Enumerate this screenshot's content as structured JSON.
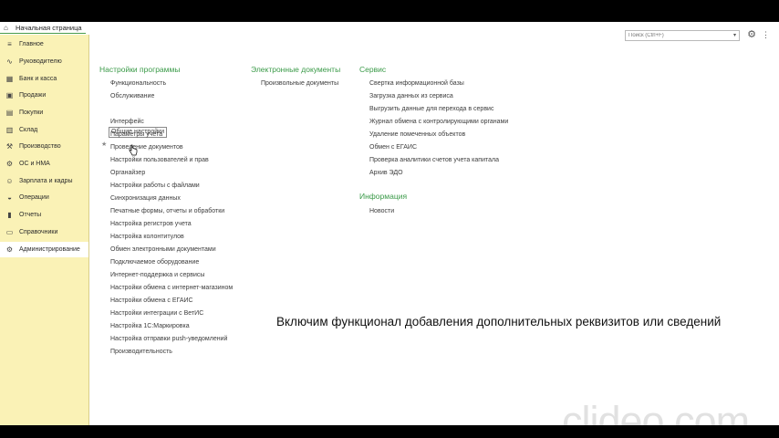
{
  "tab": {
    "home_label": "Начальная страница"
  },
  "sidebar": {
    "items": [
      {
        "label": "Главное",
        "icon": "menu-icon"
      },
      {
        "label": "Руководителю",
        "icon": "chart-icon"
      },
      {
        "label": "Банк и касса",
        "icon": "bank-icon"
      },
      {
        "label": "Продажи",
        "icon": "sales-icon"
      },
      {
        "label": "Покупки",
        "icon": "cart-icon"
      },
      {
        "label": "Склад",
        "icon": "warehouse-icon"
      },
      {
        "label": "Производство",
        "icon": "production-icon"
      },
      {
        "label": "ОС и НМА",
        "icon": "assets-icon"
      },
      {
        "label": "Зарплата и кадры",
        "icon": "people-icon"
      },
      {
        "label": "Операции",
        "icon": "operations-icon"
      },
      {
        "label": "Отчеты",
        "icon": "reports-icon"
      },
      {
        "label": "Справочники",
        "icon": "book-icon"
      },
      {
        "label": "Администрирование",
        "icon": "gear-icon"
      }
    ],
    "active_index": 12
  },
  "search": {
    "placeholder": "Поиск (Ctrl+F)"
  },
  "sections": {
    "settings": {
      "title": "Настройки программы",
      "links": [
        "Функциональность",
        "Обслуживание",
        "Общие настройки",
        "Интерфейс",
        "Параметры учета",
        "Проведение документов",
        "Настройки пользователей и прав",
        "Органайзер",
        "Настройки работы с файлами",
        "Синхронизация данных",
        "Печатные формы, отчеты и обработки",
        "Настройка регистров учета",
        "Настройка колонтитулов",
        "Обмен электронными документами",
        "Подключаемое оборудование",
        "Интернет-поддержка и сервисы",
        "Настройки обмена с интернет-магазином",
        "Настройки обмена с ЕГАИС",
        "Настройки интеграции с ВетИС",
        "Настройка 1С:Маркировка",
        "Настройка отправки push-уведомлений",
        "Производительность"
      ]
    },
    "edocs": {
      "title": "Электронные документы",
      "links": [
        "Произвольные документы"
      ]
    },
    "service": {
      "title": "Сервис",
      "links": [
        "Свертка информационной базы",
        "Загрузка данных из сервиса",
        "Выгрузить данные для перехода в сервис",
        "Журнал обмена с контролирующими органами",
        "Удаление помеченных объектов",
        "Обмен с ЕГАИС",
        "Проверка аналитики счетов учета капитала",
        "Архив ЭДО"
      ]
    },
    "info": {
      "title": "Информация",
      "links": [
        "Новости"
      ]
    }
  },
  "overlay": {
    "caption": "Включим функционал добавления дополнительных реквизитов или сведений",
    "watermark": "clideo.com"
  },
  "colors": {
    "sidebar_bg": "#faf2b6",
    "section_title": "#3a9a48",
    "frame": "#000000"
  }
}
